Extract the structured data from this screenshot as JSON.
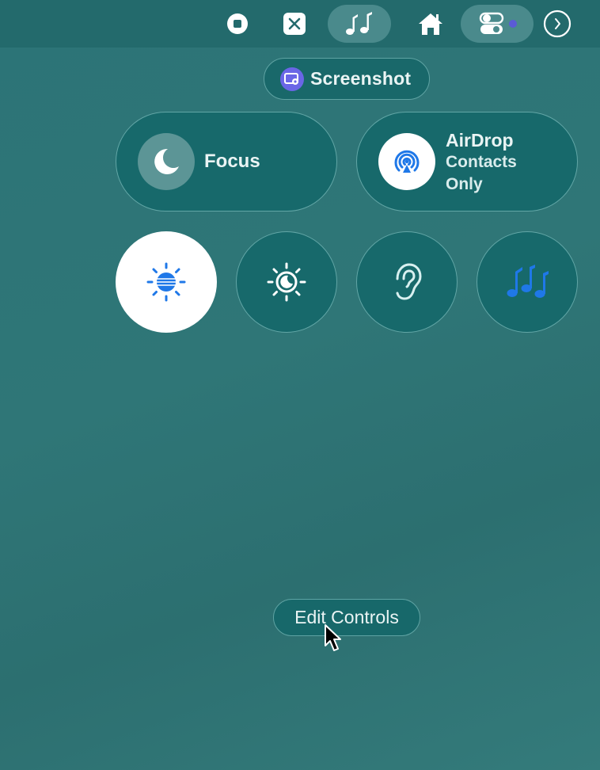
{
  "menubar": {
    "items": [
      {
        "icon": "stop-recording-icon"
      },
      {
        "icon": "close-box-icon"
      },
      {
        "icon": "music-recognition-icon",
        "active": true
      },
      {
        "icon": "home-icon"
      },
      {
        "icon": "control-center-icon",
        "active": true,
        "indicator_color": "#5b5bd6"
      },
      {
        "icon": "clock-icon"
      }
    ]
  },
  "screenshot": {
    "label": "Screenshot",
    "icon": "screenshot-icon"
  },
  "focus": {
    "label": "Focus",
    "icon": "moon-icon"
  },
  "airdrop": {
    "title": "AirDrop",
    "status_line1": "Contacts",
    "status_line2": "Only",
    "icon": "airdrop-icon"
  },
  "tiles": [
    {
      "icon": "display-brightness-icon",
      "active": true
    },
    {
      "icon": "night-shift-icon",
      "active": false
    },
    {
      "icon": "hearing-icon",
      "active": false
    },
    {
      "icon": "music-recognition-icon",
      "active": false
    }
  ],
  "edit_controls": {
    "label": "Edit Controls"
  },
  "colors": {
    "accent_blue": "#1f78e8",
    "tile_bg": "#17696b",
    "menubar_bg": "#236a6c"
  }
}
